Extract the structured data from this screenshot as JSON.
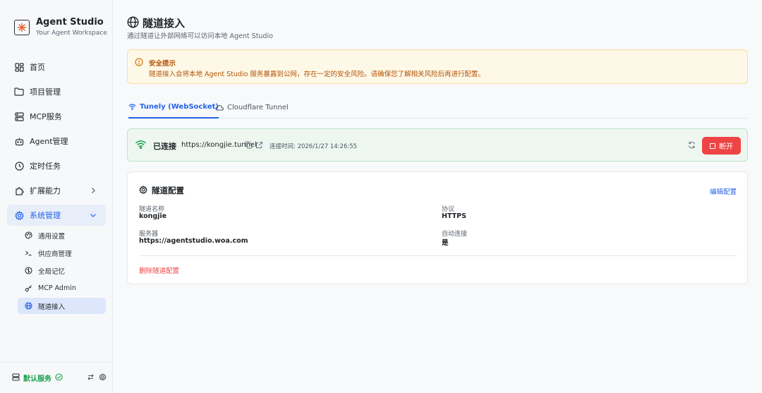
{
  "app": {
    "title": "Agent Studio",
    "subtitle": "Your Agent Workspace"
  },
  "nav": [
    {
      "label": "首页",
      "icon": "grid-icon"
    },
    {
      "label": "项目管理",
      "icon": "folder-icon"
    },
    {
      "label": "MCP服务",
      "icon": "server-icon"
    },
    {
      "label": "Agent管理",
      "icon": "bot-icon"
    },
    {
      "label": "定时任务",
      "icon": "clock-icon"
    },
    {
      "label": "扩展能力",
      "icon": "puzzle-icon"
    },
    {
      "label": "系统管理",
      "icon": "gear-icon"
    }
  ],
  "subnav": [
    {
      "label": "通用设置",
      "icon": "palette-icon"
    },
    {
      "label": "供应商管理",
      "icon": "terminal-icon"
    },
    {
      "label": "全局记忆",
      "icon": "brain-icon"
    },
    {
      "label": "MCP Admin",
      "icon": "key-icon"
    },
    {
      "label": "隧道接入",
      "icon": "globe-icon"
    }
  ],
  "footer": {
    "service_label": "默认服务"
  },
  "page": {
    "title": "隧道接入",
    "subtitle": "通过隧道让外部网络可以访问本地 Agent Studio"
  },
  "alert": {
    "title": "安全提示",
    "message": "隧道接入会将本地 Agent Studio 服务暴露到公网，存在一定的安全风险。请确保您了解相关风险后再进行配置。"
  },
  "tabs": [
    {
      "label": "Tunely (WebSocket)",
      "active": true
    },
    {
      "label": "Cloudflare Tunnel",
      "active": false
    }
  ],
  "connection": {
    "status": "已连接",
    "url": "https://kongjie.tunnel",
    "time": "连接时间: 2026/1/27 14:26:55",
    "disconnect_label": "断开"
  },
  "config": {
    "title": "隧道配置",
    "edit_label": "编辑配置",
    "fields": [
      {
        "label": "隧道名称",
        "value": "kongjie"
      },
      {
        "label": "协议",
        "value": "HTTPS"
      },
      {
        "label": "服务器",
        "value": "https://agentstudio.woa.com"
      },
      {
        "label": "自动连接",
        "value": "是"
      }
    ],
    "delete_label": "删除隧道配置"
  },
  "colors": {
    "accent": "#2563eb",
    "danger": "#ef4444",
    "success": "#16a34a",
    "warning": "#b45309"
  }
}
